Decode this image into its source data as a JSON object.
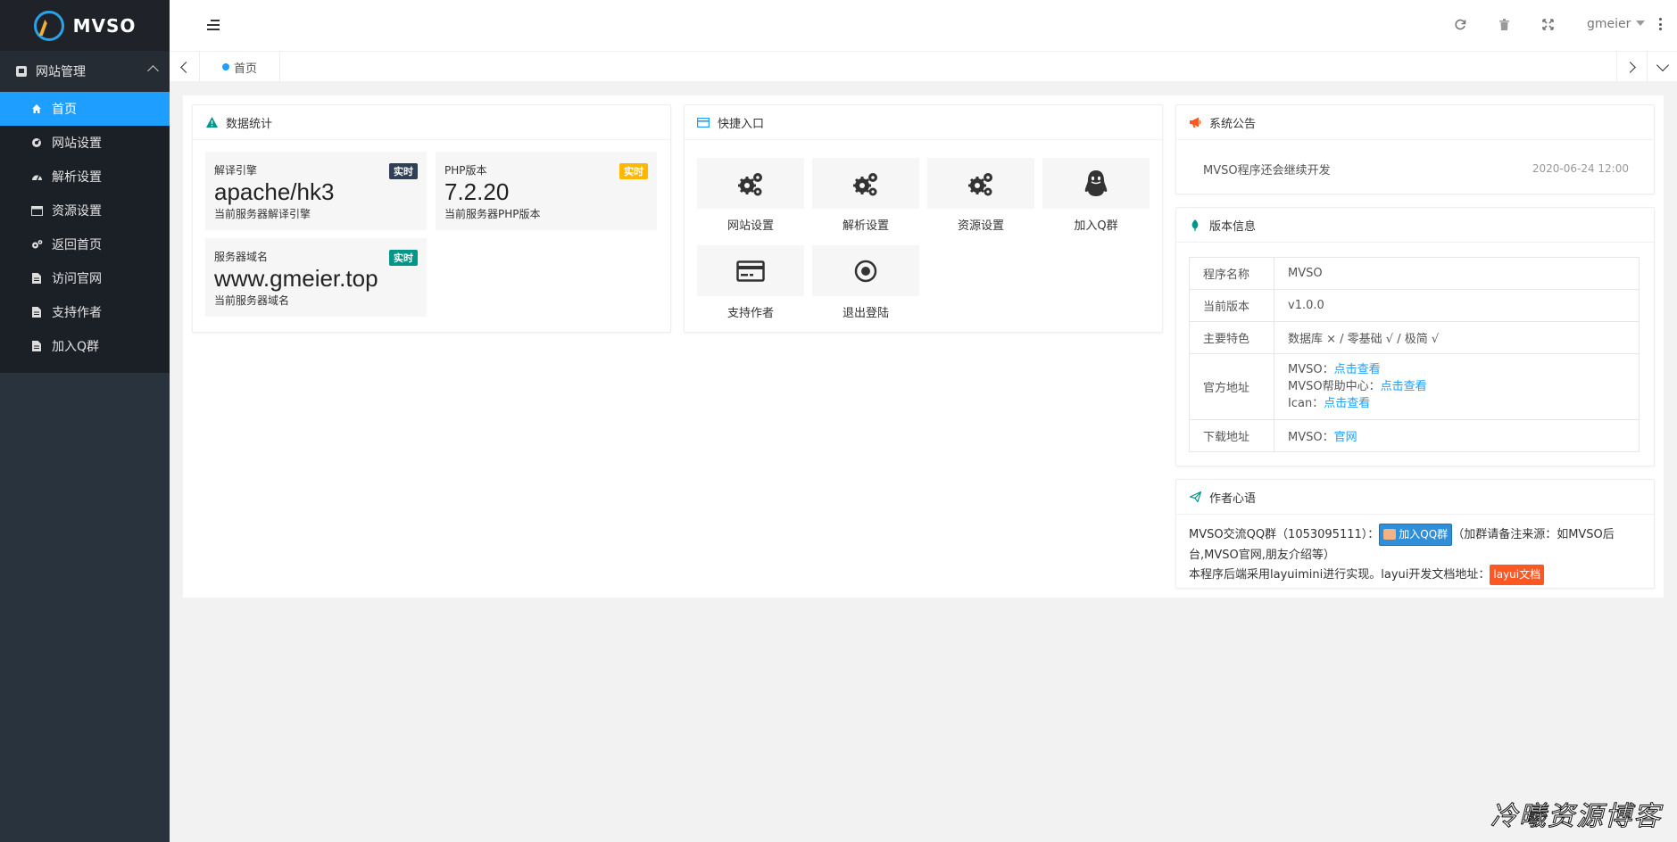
{
  "brand": {
    "name": "MVSO"
  },
  "sidebar": {
    "group_label": "网站管理",
    "items": [
      {
        "label": "首页",
        "icon": "home-icon",
        "active": true
      },
      {
        "label": "网站设置",
        "icon": "gauge-icon"
      },
      {
        "label": "解析设置",
        "icon": "dashboard-icon"
      },
      {
        "label": "资源设置",
        "icon": "window-icon"
      },
      {
        "label": "返回首页",
        "icon": "gears-icon"
      },
      {
        "label": "访问官网",
        "icon": "file-icon"
      },
      {
        "label": "支持作者",
        "icon": "file-icon"
      },
      {
        "label": "加入Q群",
        "icon": "file-icon"
      }
    ]
  },
  "header": {
    "username": "gmeier"
  },
  "tabs": {
    "home_label": "首页"
  },
  "stats_card": {
    "title": "数据统计",
    "items": [
      {
        "label": "解译引擎",
        "value": "apache/hk3",
        "desc": "当前服务器解译引擎",
        "badge": "实时",
        "badge_color": "#2f4056"
      },
      {
        "label": "PHP版本",
        "value": "7.2.20",
        "desc": "当前服务器PHP版本",
        "badge": "实时",
        "badge_color": "#ffb800"
      },
      {
        "label": "服务器域名",
        "value": "www.gmeier.top",
        "desc": "当前服务器域名",
        "badge": "实时",
        "badge_color": "#009688"
      }
    ]
  },
  "quick_card": {
    "title": "快捷入口",
    "items": [
      {
        "label": "网站设置"
      },
      {
        "label": "解析设置"
      },
      {
        "label": "资源设置"
      },
      {
        "label": "加入Q群"
      },
      {
        "label": "支持作者"
      },
      {
        "label": "退出登陆"
      }
    ]
  },
  "notice_card": {
    "title": "系统公告",
    "text": "MVSO程序还会继续开发",
    "date": "2020-06-24 12:00"
  },
  "version_card": {
    "title": "版本信息",
    "rows": {
      "name_key": "程序名称",
      "name_val": "MVSO",
      "ver_key": "当前版本",
      "ver_val": "v1.0.0",
      "feat_key": "主要特色",
      "feat_val": "数据库 × / 零基础 √ / 极简 √",
      "site_key": "官方地址",
      "site1_prefix": "MVSO：",
      "site1_link": "点击查看",
      "site2_prefix": "MVSO帮助中心：",
      "site2_link": "点击查看",
      "site3_prefix": "Ican：",
      "site3_link": "点击查看",
      "dl_key": "下载地址",
      "dl_prefix": "MVSO：",
      "dl_link": "官网"
    }
  },
  "author_card": {
    "title": "作者心语",
    "line1_prefix": "MVSO交流QQ群（1053095111）：",
    "qq_button": "加入QQ群",
    "line1_suffix": "（加群请备注来源：如MVSO后台,MVSO官网,朋友介绍等）",
    "line2_prefix": "本程序后端采用layuimini进行实现。layui开发文档地址：",
    "doc_button": "layui文档"
  },
  "watermark": "冷曦资源博客",
  "colors": {
    "accent": "#1e9fff",
    "sidebar": "#28333e",
    "menu_bg": "#1b1f26",
    "link": "#1e9fff"
  }
}
